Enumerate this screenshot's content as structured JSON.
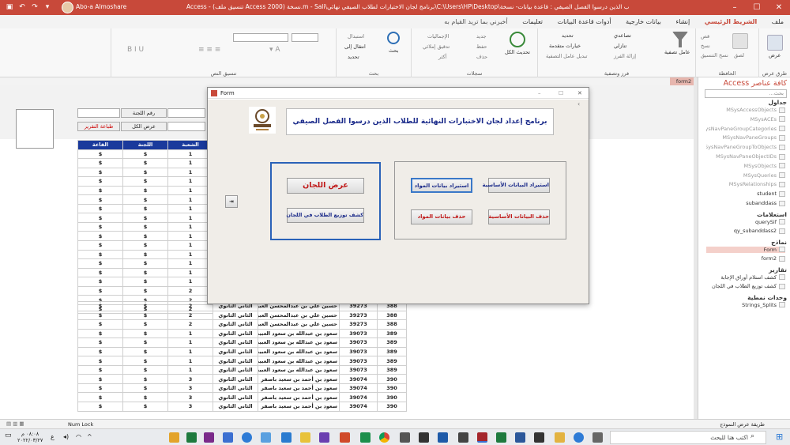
{
  "window": {
    "title": "Access - (تنسيق ملف Access 2000) نسخة.m - Sali\\برنامج لجان الاختبارات لطلاب الصيفي نهائي\\C:\\Users\\HP\\Desktop\\البرامج الخاصة بالطلاب الذين درسوا الفصل الصيفي : قاعدة بيانات- نسخة - Sali",
    "user": "Abo-a Almoshare",
    "minimize": "–",
    "maximize": "☐",
    "close": "✕"
  },
  "tabs": [
    {
      "label": "ملف"
    },
    {
      "label": "الشريط الرئيسي",
      "active": true
    },
    {
      "label": "إنشاء"
    },
    {
      "label": "بيانات خارجية"
    },
    {
      "label": "أدوات قاعدة البيانات"
    },
    {
      "label": "تعليمات"
    }
  ],
  "tell_me": "أخبرني بما تريد القيام به",
  "ribbon": {
    "groups": [
      {
        "label": "طرق عرض",
        "items": [
          "عرض"
        ]
      },
      {
        "label": "الحافظة",
        "items": [
          "لصق",
          "قص",
          "نسخ",
          "نسخ التنسيق"
        ]
      },
      {
        "label": "فرز وتصفية",
        "items": [
          "عامل تصفية",
          "تصاعدي",
          "تنازلي",
          "إزالة الفرز",
          "تحديد",
          "خيارات متقدمة",
          "تبديل عامل التصفية"
        ]
      },
      {
        "label": "سجلات",
        "items": [
          "تحديث الكل",
          "جديد",
          "حفظ",
          "حذف",
          "الإجماليات",
          "تدقيق إملائي",
          "أكثر"
        ]
      },
      {
        "label": "بحث",
        "items": [
          "بحث",
          "استبدال",
          "انتقال إلى",
          "تحديد"
        ]
      },
      {
        "label": "تنسيق النص",
        "items": []
      }
    ]
  },
  "nav_pane": {
    "title": "كافة عناصر Access",
    "search_placeholder": "بحث...",
    "tab_label": "form2",
    "sections": [
      {
        "name": "جداول",
        "items": [
          "MSysAccessObjects",
          "MSysACEs",
          "MSysNavPaneGroupCategories",
          "MSysNavPaneGroups",
          "MSysNavPaneGroupToObjects",
          "MSysNavPaneObjectIDs",
          "MSysObjects",
          "MSysQueries",
          "MSysRelationships",
          "student",
          "subanddass"
        ]
      },
      {
        "name": "استعلامات",
        "items": [
          "querySif",
          "qy_subanddass2"
        ]
      },
      {
        "name": "نماذج",
        "items": [
          "Form",
          "form2"
        ]
      },
      {
        "name": "تقارير",
        "items": [
          "كشف استلام أوراق الإجابة",
          "كشف توزيع الطلاب في اللجان"
        ]
      },
      {
        "name": "وحدات نمطية",
        "items": [
          "Strings_Splits"
        ]
      }
    ]
  },
  "bg_form": {
    "committee_label": "رقم اللجنة",
    "show_committee": "عرض الكل",
    "print_report": "طباعة التقرير",
    "headers": [
      "القاعة",
      "اللجنة",
      "الشعبة"
    ],
    "rows_top": [
      [
        "$",
        "$",
        "1"
      ],
      [
        "$",
        "$",
        "1"
      ],
      [
        "$",
        "$",
        "1"
      ],
      [
        "$",
        "$",
        "1"
      ],
      [
        "$",
        "$",
        "1"
      ],
      [
        "$",
        "$",
        "1"
      ],
      [
        "$",
        "$",
        "1"
      ],
      [
        "$",
        "$",
        "1"
      ],
      [
        "$",
        "$",
        "1"
      ],
      [
        "$",
        "$",
        "1"
      ],
      [
        "$",
        "$",
        "1"
      ],
      [
        "$",
        "$",
        "1"
      ],
      [
        "$",
        "$",
        "1"
      ],
      [
        "$",
        "$",
        "1"
      ],
      [
        "$",
        "$",
        "1"
      ],
      [
        "$",
        "$",
        "2"
      ],
      [
        "$",
        "$",
        "2"
      ],
      [
        "$",
        "$",
        "2"
      ]
    ],
    "rows_bottom": [
      {
        "q": "$",
        "l": "$",
        "s": "2",
        "grade": "الثاني الثانوي",
        "name": "حسين علي بن عبدالمحسن العبيلي",
        "id": "39273",
        "num": "388"
      },
      {
        "q": "$",
        "l": "$",
        "s": "2",
        "grade": "الثاني الثانوي",
        "name": "حسين علي بن عبدالمحسن العبيلي",
        "id": "39273",
        "num": "388"
      },
      {
        "q": "$",
        "l": "$",
        "s": "2",
        "grade": "الثاني الثانوي",
        "name": "حسين علي بن عبدالمحسن العبيلي",
        "id": "39273",
        "num": "388"
      },
      {
        "q": "$",
        "l": "$",
        "s": "1",
        "grade": "الثاني الثانوي",
        "name": "سعود بن عبدالله بن سعود العبيد",
        "id": "39073",
        "num": "389"
      },
      {
        "q": "$",
        "l": "$",
        "s": "1",
        "grade": "الثاني الثانوي",
        "name": "سعود بن عبدالله بن سعود العبيد",
        "id": "39073",
        "num": "389"
      },
      {
        "q": "$",
        "l": "$",
        "s": "1",
        "grade": "الثاني الثانوي",
        "name": "سعود بن عبدالله بن سعود العبيد",
        "id": "39073",
        "num": "389"
      },
      {
        "q": "$",
        "l": "$",
        "s": "1",
        "grade": "الثاني الثانوي",
        "name": "سعود بن عبدالله بن سعود العبيد",
        "id": "39073",
        "num": "389"
      },
      {
        "q": "$",
        "l": "$",
        "s": "1",
        "grade": "الثاني الثانوي",
        "name": "سعود بن عبدالله بن سعود العبيد",
        "id": "39073",
        "num": "389"
      },
      {
        "q": "$",
        "l": "$",
        "s": "3",
        "grade": "الثاني الثانوي",
        "name": "سعود بن أحمد بن سعيد باصقر",
        "id": "39074",
        "num": "390"
      },
      {
        "q": "$",
        "l": "$",
        "s": "3",
        "grade": "الثاني الثانوي",
        "name": "سعود بن أحمد بن سعيد باصقر",
        "id": "39074",
        "num": "390"
      },
      {
        "q": "$",
        "l": "$",
        "s": "3",
        "grade": "الثاني الثانوي",
        "name": "سعود بن أحمد بن سعيد باصقر",
        "id": "39074",
        "num": "390"
      },
      {
        "q": "$",
        "l": "$",
        "s": "3",
        "grade": "الثاني الثانوي",
        "name": "سعود بن أحمد بن سعيد باصقر",
        "id": "39074",
        "num": "390"
      }
    ]
  },
  "dialog": {
    "title": "Form",
    "heading": "برنامج إعداد لجان الاختبارات النهائية  للطلاب الذين درسوا الفصل الصيفي",
    "btn_show_committees": "عرض اللجان",
    "btn_distribution": "كشف توزيع الطلاب في اللجان",
    "btn_import_basic": "استيراد البيانات الأساسية",
    "btn_import_subjects": "استيراد بيانات المواد",
    "btn_delete_basic": "حذف البيانات الأساسية",
    "btn_delete_subjects": "حذف بيانات المواد"
  },
  "status": {
    "numlock": "Num Lock",
    "view": "طريقة عرض النموذج"
  },
  "taskbar": {
    "search": "اكتب هنا للبحث",
    "time": "٠٨:٠٨ م",
    "date": "٢٠٢٢/٠٣/٢٧"
  },
  "colors": {
    "accent": "#c8493a",
    "header_blue": "#1a3a9c",
    "dialog_frame": "#2a62b8"
  }
}
